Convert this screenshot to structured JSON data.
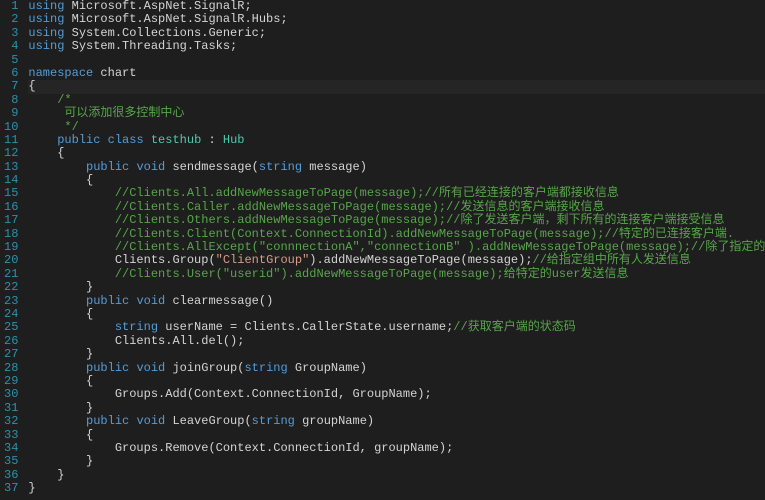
{
  "lines": [
    {
      "num": 1,
      "indent": 0,
      "fold": "open",
      "tokens": [
        [
          "kw",
          "using"
        ],
        [
          "id",
          " Microsoft.AspNet.SignalR;"
        ]
      ]
    },
    {
      "num": 2,
      "indent": 0,
      "tokens": [
        [
          "kw",
          "using"
        ],
        [
          "id",
          " Microsoft.AspNet.SignalR.Hubs;"
        ]
      ]
    },
    {
      "num": 3,
      "indent": 0,
      "tokens": [
        [
          "kw",
          "using"
        ],
        [
          "id",
          " System.Collections.Generic;"
        ]
      ]
    },
    {
      "num": 4,
      "indent": 0,
      "tokens": [
        [
          "kw",
          "using"
        ],
        [
          "id",
          " System.Threading.Tasks;"
        ]
      ]
    },
    {
      "num": 5,
      "indent": 0,
      "tokens": []
    },
    {
      "num": 6,
      "indent": 0,
      "fold": "open",
      "tokens": [
        [
          "kw",
          "namespace"
        ],
        [
          "id",
          " chart"
        ]
      ]
    },
    {
      "num": 7,
      "indent": 0,
      "highlight": true,
      "tokens": [
        [
          "punc",
          "{"
        ]
      ]
    },
    {
      "num": 8,
      "indent": 1,
      "fold": "open",
      "tokens": [
        [
          "cmt",
          "/*"
        ]
      ]
    },
    {
      "num": 9,
      "indent": 1,
      "tokens": [
        [
          "cmt",
          " 可以添加很多控制中心"
        ]
      ]
    },
    {
      "num": 10,
      "indent": 1,
      "tokens": [
        [
          "cmt",
          " */"
        ]
      ]
    },
    {
      "num": 11,
      "indent": 1,
      "fold": "open",
      "tokens": [
        [
          "kw",
          "public"
        ],
        [
          "id",
          " "
        ],
        [
          "kw",
          "class"
        ],
        [
          "id",
          " "
        ],
        [
          "cls",
          "testhub"
        ],
        [
          "id",
          " : "
        ],
        [
          "cls",
          "Hub"
        ]
      ]
    },
    {
      "num": 12,
      "indent": 1,
      "tokens": [
        [
          "punc",
          "{"
        ]
      ]
    },
    {
      "num": 13,
      "indent": 2,
      "fold": "open",
      "tokens": [
        [
          "kw",
          "public"
        ],
        [
          "id",
          " "
        ],
        [
          "kw",
          "void"
        ],
        [
          "id",
          " sendmessage("
        ],
        [
          "kw",
          "string"
        ],
        [
          "id",
          " message)"
        ]
      ]
    },
    {
      "num": 14,
      "indent": 2,
      "tokens": [
        [
          "punc",
          "{"
        ]
      ]
    },
    {
      "num": 15,
      "indent": 3,
      "tokens": [
        [
          "cmt",
          "//Clients.All.addNewMessageToPage(message);//所有已经连接的客户端都接收信息"
        ]
      ]
    },
    {
      "num": 16,
      "indent": 3,
      "tokens": [
        [
          "cmt",
          "//Clients.Caller.addNewMessageToPage(message);//发送信息的客户端接收信息"
        ]
      ]
    },
    {
      "num": 17,
      "indent": 3,
      "tokens": [
        [
          "cmt",
          "//Clients.Others.addNewMessageToPage(message);//除了发送客户端，剩下所有的连接客户端接受信息"
        ]
      ]
    },
    {
      "num": 18,
      "indent": 3,
      "tokens": [
        [
          "cmt",
          "//Clients.Client(Context.ConnectionId).addNewMessageToPage(message);//特定的已连接客户端."
        ]
      ]
    },
    {
      "num": 19,
      "indent": 3,
      "tokens": [
        [
          "cmt",
          "//Clients.AllExcept(\"connnectionA\",\"connectionB\" ).addNewMessageToPage(message);//除了指定的ID别的都接收信息"
        ]
      ]
    },
    {
      "num": 20,
      "indent": 3,
      "tokens": [
        [
          "id",
          "Clients.Group("
        ],
        [
          "str",
          "\"ClientGroup\""
        ],
        [
          "id",
          ").addNewMessageToPage(message);"
        ],
        [
          "cmt",
          "//给指定组中所有人发送信息"
        ]
      ]
    },
    {
      "num": 21,
      "indent": 3,
      "tokens": [
        [
          "cmt",
          "//Clients.User(\"userid\").addNewMessageToPage(message);给特定的user发送信息"
        ]
      ]
    },
    {
      "num": 22,
      "indent": 2,
      "tokens": [
        [
          "punc",
          "}"
        ]
      ]
    },
    {
      "num": 23,
      "indent": 2,
      "fold": "open",
      "tokens": [
        [
          "kw",
          "public"
        ],
        [
          "id",
          " "
        ],
        [
          "kw",
          "void"
        ],
        [
          "id",
          " clearmessage()"
        ]
      ]
    },
    {
      "num": 24,
      "indent": 2,
      "tokens": [
        [
          "punc",
          "{"
        ]
      ]
    },
    {
      "num": 25,
      "indent": 3,
      "tokens": [
        [
          "kw",
          "string"
        ],
        [
          "id",
          " userName = Clients.CallerState.username;"
        ],
        [
          "cmt",
          "//获取客户端的状态码"
        ]
      ]
    },
    {
      "num": 26,
      "indent": 3,
      "tokens": [
        [
          "id",
          "Clients.All.del();"
        ]
      ]
    },
    {
      "num": 27,
      "indent": 2,
      "tokens": [
        [
          "punc",
          "}"
        ]
      ]
    },
    {
      "num": 28,
      "indent": 2,
      "fold": "open",
      "tokens": [
        [
          "kw",
          "public"
        ],
        [
          "id",
          " "
        ],
        [
          "kw",
          "void"
        ],
        [
          "id",
          " joinGroup("
        ],
        [
          "kw",
          "string"
        ],
        [
          "id",
          " GroupName)"
        ]
      ]
    },
    {
      "num": 29,
      "indent": 2,
      "tokens": [
        [
          "punc",
          "{"
        ]
      ]
    },
    {
      "num": 30,
      "indent": 3,
      "tokens": [
        [
          "id",
          "Groups.Add(Context.ConnectionId, GroupName);"
        ]
      ]
    },
    {
      "num": 31,
      "indent": 2,
      "tokens": [
        [
          "punc",
          "}"
        ]
      ]
    },
    {
      "num": 32,
      "indent": 2,
      "fold": "open",
      "tokens": [
        [
          "kw",
          "public"
        ],
        [
          "id",
          " "
        ],
        [
          "kw",
          "void"
        ],
        [
          "id",
          " LeaveGroup("
        ],
        [
          "kw",
          "string"
        ],
        [
          "id",
          " groupName)"
        ]
      ]
    },
    {
      "num": 33,
      "indent": 2,
      "tokens": [
        [
          "punc",
          "{"
        ]
      ]
    },
    {
      "num": 34,
      "indent": 3,
      "tokens": [
        [
          "id",
          "Groups.Remove(Context.ConnectionId, groupName);"
        ]
      ]
    },
    {
      "num": 35,
      "indent": 2,
      "tokens": [
        [
          "punc",
          "}"
        ]
      ]
    },
    {
      "num": 36,
      "indent": 1,
      "tokens": [
        [
          "punc",
          "}"
        ]
      ]
    },
    {
      "num": 37,
      "indent": 0,
      "tokens": [
        [
          "punc",
          "}"
        ]
      ]
    }
  ],
  "indentUnit": "    "
}
